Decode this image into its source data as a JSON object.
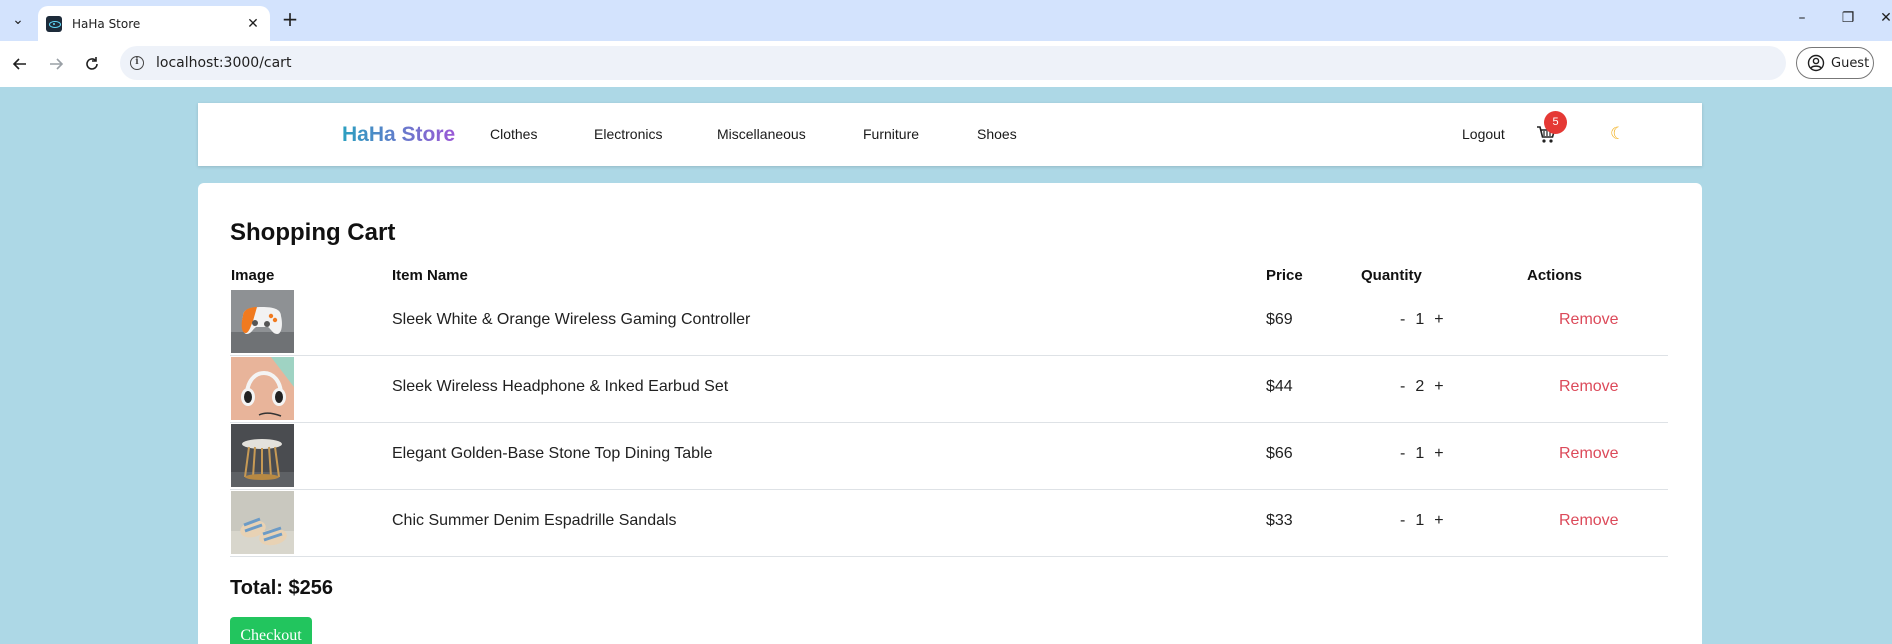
{
  "browser": {
    "tab_title": "HaHa Store",
    "url": "localhost:3000/cart",
    "profile_label": "Guest"
  },
  "nav": {
    "brand": "HaHa Store",
    "links": [
      "Clothes",
      "Electronics",
      "Miscellaneous",
      "Furniture",
      "Shoes"
    ],
    "logout": "Logout",
    "cart_count": "5",
    "theme_icon": "moon-icon",
    "cart_icon": "cart-icon"
  },
  "cart": {
    "heading": "Shopping Cart",
    "columns": [
      "Image",
      "Item Name",
      "Price",
      "Quantity",
      "Actions"
    ],
    "items": [
      {
        "name": "Sleek White & Orange Wireless Gaming Controller",
        "price": "$69",
        "quantity": "1",
        "decrement": "-",
        "increment": "+",
        "action": "Remove"
      },
      {
        "name": "Sleek Wireless Headphone & Inked Earbud Set",
        "price": "$44",
        "quantity": "2",
        "decrement": "-",
        "increment": "+",
        "action": "Remove"
      },
      {
        "name": "Elegant Golden-Base Stone Top Dining Table",
        "price": "$66",
        "quantity": "1",
        "decrement": "-",
        "increment": "+",
        "action": "Remove"
      },
      {
        "name": "Chic Summer Denim Espadrille Sandals",
        "price": "$33",
        "quantity": "1",
        "decrement": "-",
        "increment": "+",
        "action": "Remove"
      }
    ],
    "total": "Total: $256",
    "checkout": "Checkout"
  },
  "colors": {
    "page_bg": "#add8e6",
    "checkout": "#22c55e",
    "remove": "#dc4a5a",
    "badge": "#e53935"
  }
}
